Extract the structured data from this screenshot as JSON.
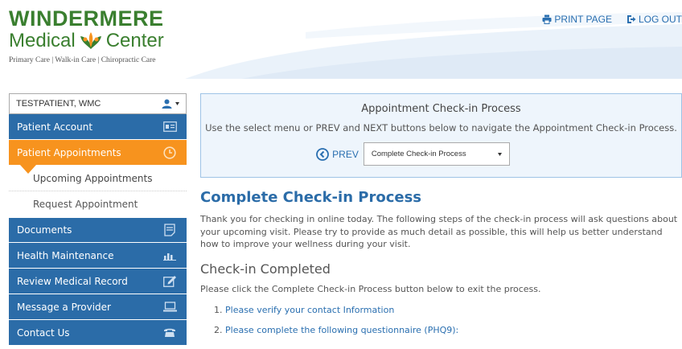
{
  "header": {
    "logo": {
      "line1": "WINDERMERE",
      "line2_left": "Medical",
      "line2_right": "Center",
      "tagline": "Primary Care | Walk-in Care | Chiropractic Care"
    },
    "print_label": "PRINT PAGE",
    "logout_label": "LOG OUT"
  },
  "sidebar": {
    "patient_name": "TESTPATIENT, WMC",
    "items": [
      {
        "label": "Patient Account",
        "icon": "id-card-icon"
      },
      {
        "label": "Patient Appointments",
        "icon": "clock-icon",
        "active": true
      },
      {
        "label": "Upcoming Appointments",
        "sub": true
      },
      {
        "label": "Request Appointment",
        "sub": true
      },
      {
        "label": "Documents",
        "icon": "document-icon"
      },
      {
        "label": "Health Maintenance",
        "icon": "bar-chart-icon"
      },
      {
        "label": "Review Medical Record",
        "icon": "edit-icon"
      },
      {
        "label": "Message a Provider",
        "icon": "laptop-icon"
      },
      {
        "label": "Contact Us",
        "icon": "phone-icon"
      }
    ]
  },
  "checkin": {
    "title": "Appointment Check-in Process",
    "description": "Use the select menu or PREV and NEXT buttons below to navigate the Appointment Check-in Process.",
    "prev_label": "PREV",
    "selected_step": "Complete Check-in Process"
  },
  "main": {
    "page_title": "Complete Check-in Process",
    "intro": "Thank you for checking in online today. The following steps of the check-in process will ask questions about your upcoming visit. Please try to provide as much detail as possible, this will help us better understand how to improve your wellness during your visit.",
    "section_title": "Check-in Completed",
    "section_text": "Please click the Complete Check-in Process button below to exit the process.",
    "steps": [
      {
        "number": "1.",
        "label": "Please verify your contact Information"
      },
      {
        "number": "2.",
        "label": "Please complete the following questionnaire (PHQ9):"
      }
    ]
  },
  "colors": {
    "nav_blue": "#2b6ca8",
    "nav_active": "#f7931e",
    "brand_green": "#3a7f2f",
    "link_blue": "#2a6fb0"
  }
}
